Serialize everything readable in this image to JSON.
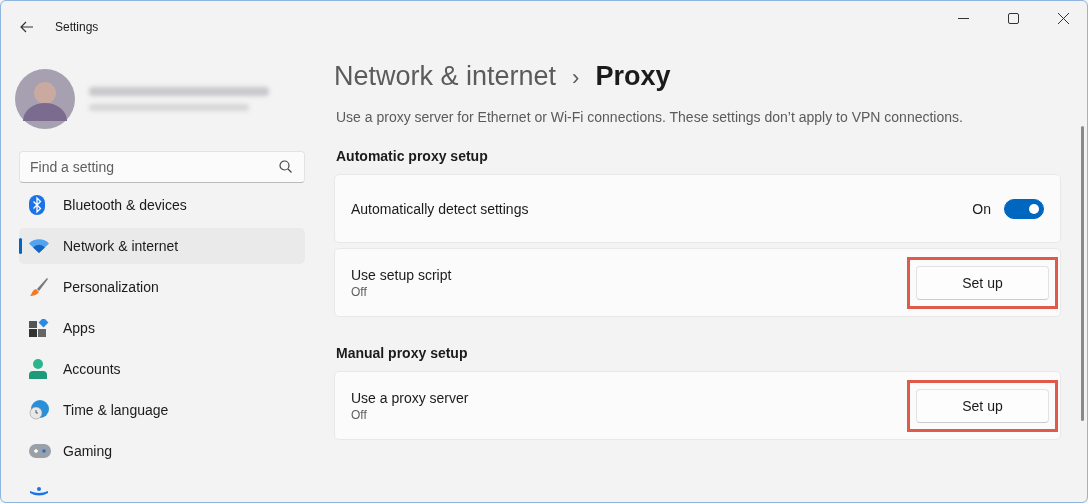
{
  "window": {
    "title": "Settings"
  },
  "search": {
    "placeholder": "Find a setting"
  },
  "sidebar": {
    "items": [
      {
        "label": "Bluetooth & devices",
        "kind": "bluetooth",
        "selected": false
      },
      {
        "label": "Network & internet",
        "kind": "network",
        "selected": true
      },
      {
        "label": "Personalization",
        "kind": "personalization",
        "selected": false
      },
      {
        "label": "Apps",
        "kind": "apps",
        "selected": false
      },
      {
        "label": "Accounts",
        "kind": "accounts",
        "selected": false
      },
      {
        "label": "Time & language",
        "kind": "time",
        "selected": false
      },
      {
        "label": "Gaming",
        "kind": "gaming",
        "selected": false
      },
      {
        "kind": "accessibility",
        "selected": false
      }
    ]
  },
  "breadcrumb": {
    "parent": "Network & internet",
    "separator": "›",
    "current": "Proxy"
  },
  "description": "Use a proxy server for Ethernet or Wi-Fi connections. These settings don’t apply to VPN connections.",
  "sections": [
    {
      "heading": "Automatic proxy setup",
      "rows": [
        {
          "kind": "toggle",
          "title": "Automatically detect settings",
          "state_label": "On",
          "on": true
        },
        {
          "kind": "button",
          "title": "Use setup script",
          "subtitle": "Off",
          "button": "Set up",
          "highlighted": true
        }
      ]
    },
    {
      "heading": "Manual proxy setup",
      "rows": [
        {
          "kind": "button",
          "title": "Use a proxy server",
          "subtitle": "Off",
          "button": "Set up",
          "highlighted": true
        }
      ]
    }
  ]
}
